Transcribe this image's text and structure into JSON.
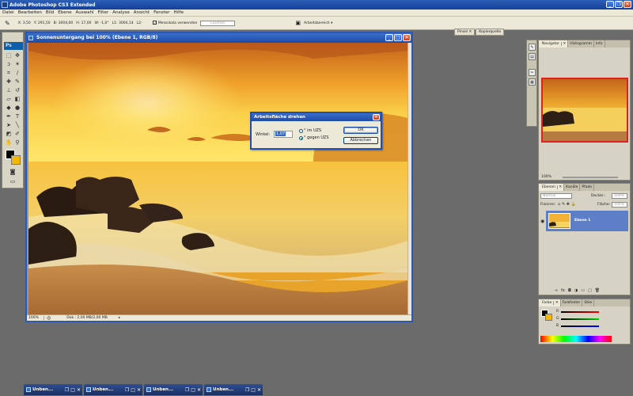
{
  "app": {
    "title": "Adobe Photoshop CS3 Extended"
  },
  "menu": [
    "Datei",
    "Bearbeiten",
    "Bild",
    "Ebene",
    "Auswahl",
    "Filter",
    "Analyse",
    "Ansicht",
    "Fenster",
    "Hilfe"
  ],
  "options": {
    "x": "X: 3,50",
    "y": "Y: 291,50",
    "b": "B: 3004,00",
    "h": "H: 17,00",
    "w": "W: -1,0°",
    "l1": "L1: 3004,14",
    "l2": "L2:",
    "use_scale_label": "Messskala verwenden",
    "clear_label": "Löschen",
    "workspace_label": "Arbeitsbereich ▾"
  },
  "top_panel_tabs": [
    "Pinsel",
    "Kopierquelle"
  ],
  "document": {
    "title": "Sonnenuntergang bei 100% (Ebene 1, RGB/8)",
    "zoom": "100%",
    "doc_info": "Dok.: 2,00 MB/2,00 MB"
  },
  "dialog": {
    "title": "Arbeitsfläche drehen",
    "angle_label": "Winkel:",
    "angle_value": "1,07",
    "cw_label": "° im UZS",
    "ccw_label": "° gegen UZS",
    "ok_label": "OK",
    "cancel_label": "Abbrechen"
  },
  "navigator_panel": {
    "tabs": [
      "Navigator",
      "Histogramm",
      "Info"
    ],
    "zoom": "100%"
  },
  "layers_panel": {
    "tabs": [
      "Ebenen",
      "Kanäle",
      "Pfade"
    ],
    "blend_mode": "Normal",
    "opacity_label": "Deckkr.:",
    "opacity_value": "100%",
    "lock_label": "Fixieren:",
    "fill_label": "Fläche:",
    "fill_value": "100%",
    "layer_name": "Ebene 1"
  },
  "color_panel": {
    "tabs": [
      "Farbe",
      "Farbfelder",
      "Stile"
    ],
    "r_label": "R",
    "g_label": "G",
    "b_label": "B"
  },
  "minimized_docs": [
    "Unben...",
    "Unben...",
    "Unben...",
    "Unben..."
  ],
  "colors": {
    "title_bar": "#1d4aa8",
    "foreground": "#000000",
    "background": "#f5b800",
    "panel": "#d6d3c4"
  }
}
